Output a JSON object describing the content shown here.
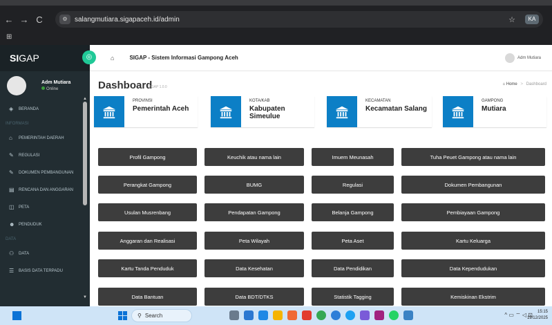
{
  "browser": {
    "back": "←",
    "forward": "→",
    "reload": "C",
    "site_icon": "⚙",
    "url": "salangmutiara.sigapaceh.id/admin",
    "star": "☆",
    "profile": "KA",
    "apps": "⊞"
  },
  "sidebar": {
    "logo_bold": "SI",
    "logo_rest": "GAP",
    "toggle": "◎",
    "user_name": "Adm Mutiara",
    "user_status": "Online",
    "items": [
      {
        "type": "item",
        "icon": "◈",
        "label": "BERANDA"
      },
      {
        "type": "header",
        "label": "INFORMASI"
      },
      {
        "type": "item",
        "icon": "⌂",
        "label": "PEMERINTAH DAERAH"
      },
      {
        "type": "item",
        "icon": "✎",
        "label": "REGULASI"
      },
      {
        "type": "item",
        "icon": "✎",
        "label": "DOKUMEN PEMBANGUNAN"
      },
      {
        "type": "item",
        "icon": "▤",
        "label": "RENCANA DAN ANGGARAN"
      },
      {
        "type": "item",
        "icon": "◫",
        "label": "PETA"
      },
      {
        "type": "item",
        "icon": "☻",
        "label": "PENDUDUK"
      },
      {
        "type": "header",
        "label": "DATA"
      },
      {
        "type": "item",
        "icon": "⚇",
        "label": "DATA"
      },
      {
        "type": "item",
        "icon": "☰",
        "label": "BASIS DATA TERPADU"
      }
    ]
  },
  "topbar": {
    "home_icon": "⌂",
    "title": "SIGAP - Sistem Informasi Gampong Aceh",
    "user": "Adm Mutiara"
  },
  "page": {
    "title": "Dashboard",
    "subtitle": "SIGAP 1.0.0",
    "breadcrumb_home": "Home",
    "breadcrumb_sep": ">",
    "breadcrumb_current": "Dashboard"
  },
  "info_boxes": [
    {
      "label": "PROVINSI",
      "value": "Pemerintah Aceh"
    },
    {
      "label": "KOTA/KAB",
      "value": "Kabupaten Simeulue"
    },
    {
      "label": "KECAMATAN",
      "value": "Kecamatan Salang"
    },
    {
      "label": "GAMPONG",
      "value": "Mutiara"
    }
  ],
  "buttons": [
    "Profil Gampong",
    "Keuchik atau nama lain",
    "Imuem Meunasah",
    "Tuha Peuet Gampong atau nama lain",
    "Perangkat Gampong",
    "BUMG",
    "Regulasi",
    "Dokumen Pembangunan",
    "Usulan Musrenbang",
    "Pendapatan Gampong",
    "Belanja Gampong",
    "Pembiayaan Gampong",
    "Anggaran dan Realisasi",
    "Peta Wilayah",
    "Peta Aset",
    "Kartu Keluarga",
    "Kartu Tanda Penduduk",
    "Data Kesehatan",
    "Data Pendidikan",
    "Data Kependudukan",
    "Data Bantuan",
    "Data BDT/DTKS",
    "Statistik Tagging",
    "Kemiskinan Ekstrim"
  ],
  "taskbar": {
    "search": "Search",
    "search_icon": "⚲",
    "tray": "^ ▭ ⌔ ◁ ⊡",
    "time": "15:15",
    "date": "19/12/2025"
  }
}
